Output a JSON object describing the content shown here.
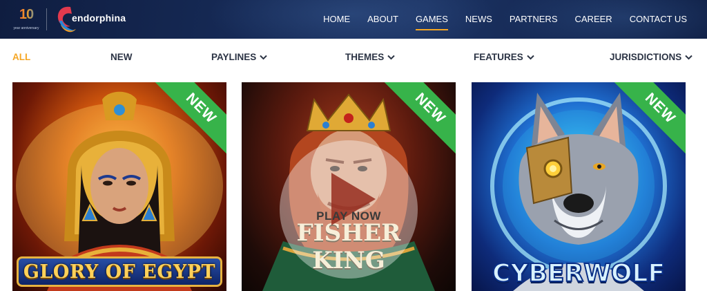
{
  "brand": {
    "anniversary_number": "10",
    "anniversary_caption": "year anniversary",
    "name": "endorphina"
  },
  "nav": {
    "items": [
      {
        "label": "HOME"
      },
      {
        "label": "ABOUT"
      },
      {
        "label": "GAMES",
        "active": true
      },
      {
        "label": "NEWS"
      },
      {
        "label": "PARTNERS"
      },
      {
        "label": "CAREER"
      },
      {
        "label": "CONTACT US"
      }
    ]
  },
  "filters": {
    "items": [
      {
        "label": "ALL",
        "active": true
      },
      {
        "label": "NEW"
      },
      {
        "label": "PAYLINES",
        "dropdown": true
      },
      {
        "label": "THEMES",
        "dropdown": true
      },
      {
        "label": "FEATURES",
        "dropdown": true
      },
      {
        "label": "JURISDICTIONS",
        "dropdown": true
      }
    ]
  },
  "games": [
    {
      "title": "GLORY OF EGYPT",
      "badge": "NEW"
    },
    {
      "title_line1": "FISHER",
      "title_line2": "KING",
      "badge": "NEW",
      "overlay_label": "PLAY NOW"
    },
    {
      "title": "CYBERWOLF",
      "badge": "NEW"
    }
  ],
  "colors": {
    "header_bg": "#162a56",
    "accent": "#f5a623",
    "filter_text": "#2b3344",
    "badge_green": "#37b34a"
  }
}
